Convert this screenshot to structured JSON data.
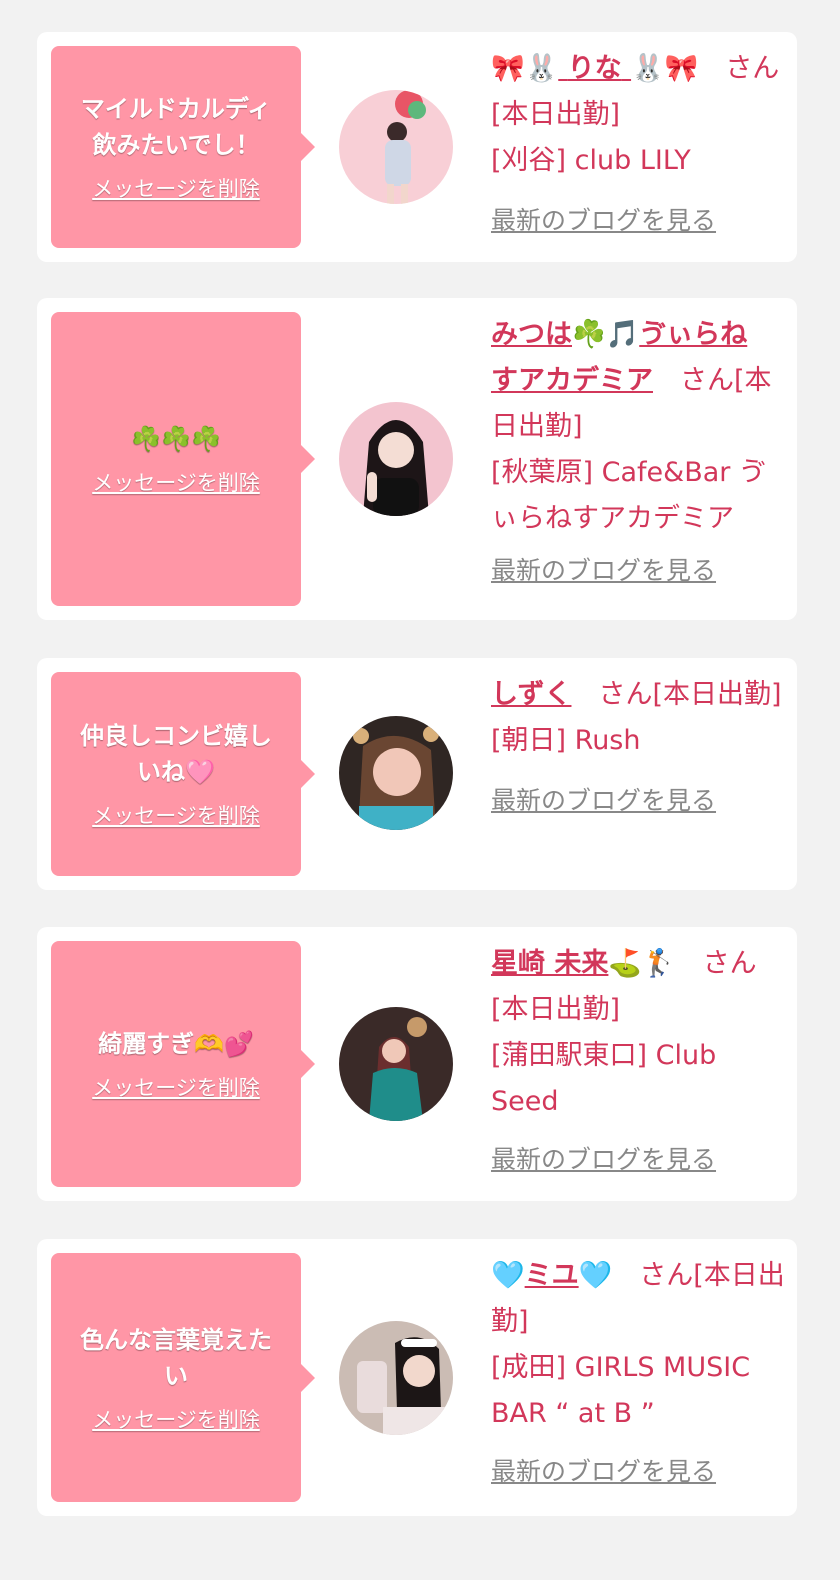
{
  "common": {
    "delete_label": "メッセージを削除",
    "blog_label": "最新のブログを見る",
    "san": "さん",
    "status": "[本日出勤]"
  },
  "colors": {
    "page_bg": "#f2f2f2",
    "card_bg": "#ffffff",
    "bubble_bg": "#ff96a6",
    "accent": "#d2375a",
    "link_gray": "#888888"
  },
  "cards": [
    {
      "message_lines": [
        "マイルドカルディ",
        "飲みたいでし！"
      ],
      "name": "りな",
      "name_emoji_left": "🎀🐰",
      "name_emoji_right": "🐰🎀",
      "shop": "[刈谷] club LILY"
    },
    {
      "message_lines": [
        "☘️☘️☘️"
      ],
      "name_line1": "みつは",
      "name_emoji": "☘️🎵",
      "name_line1b": "ゔぃらね",
      "name_line2": "すアカデミア",
      "shop_line1": "[秋葉原] Cafe&Bar ゔ",
      "shop_line2": "ぃらねすアカデミア"
    },
    {
      "message_lines": [
        "仲良しコンビ嬉し",
        "いね🩷"
      ],
      "name": "しずく",
      "shop": "[朝日] Rush"
    },
    {
      "message_lines": [
        "綺麗すぎ🫶💕"
      ],
      "name": "星崎 未来",
      "name_emoji": "⛳🏌️",
      "shop_line1": "[蒲田駅東口] Club",
      "shop_line2": "Seed"
    },
    {
      "message_lines": [
        "色んな言葉覚えた",
        "い"
      ],
      "name": "ミユ",
      "name_emoji": "🩵",
      "shop_line1": "[成田] GIRLS MUSIC",
      "shop_line2": "BAR “ at B ”"
    }
  ]
}
